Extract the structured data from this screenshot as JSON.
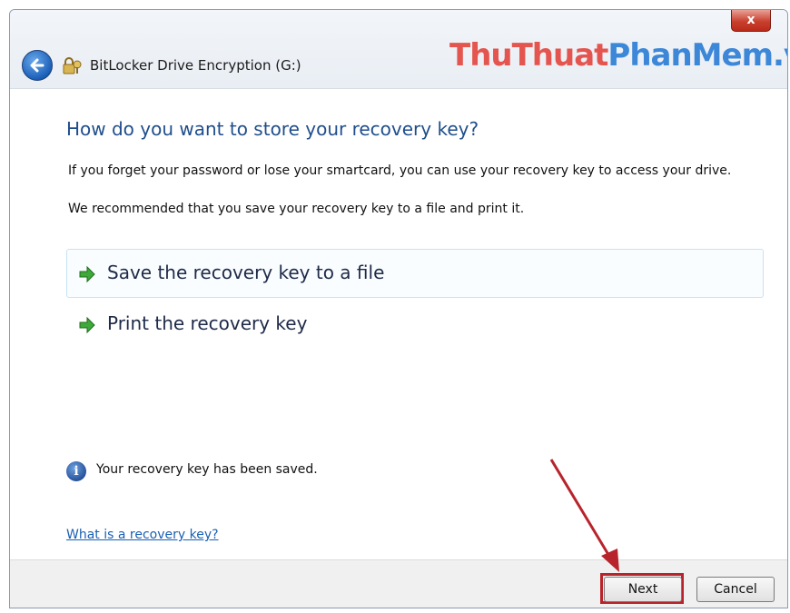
{
  "window": {
    "title": "BitLocker Drive Encryption (G:)",
    "close_glyph": "x",
    "back_icon": "back-arrow-icon",
    "app_icon": "bitlocker-icon"
  },
  "watermark": {
    "part1": "ThuThuat",
    "part2": "PhanMem.vn"
  },
  "content": {
    "heading": "How do you want to store your recovery key?",
    "paragraph1": "If you forget your password or lose your smartcard, you can use your recovery key to access your drive.",
    "paragraph2": "We recommended that you save your recovery key to a file and print it.",
    "options": [
      {
        "label": "Save the recovery key to a file",
        "icon": "green-arrow-icon"
      },
      {
        "label": "Print the recovery key",
        "icon": "green-arrow-icon"
      }
    ],
    "info_message": "Your recovery key has been saved.",
    "help_link": "What is a recovery key?"
  },
  "footer": {
    "next_label": "Next",
    "cancel_label": "Cancel"
  },
  "colors": {
    "heading": "#1f4e8c",
    "link": "#1a5fb4",
    "highlight": "#b8242b",
    "watermark_red": "#e5554f",
    "watermark_blue": "#3c87d8"
  }
}
